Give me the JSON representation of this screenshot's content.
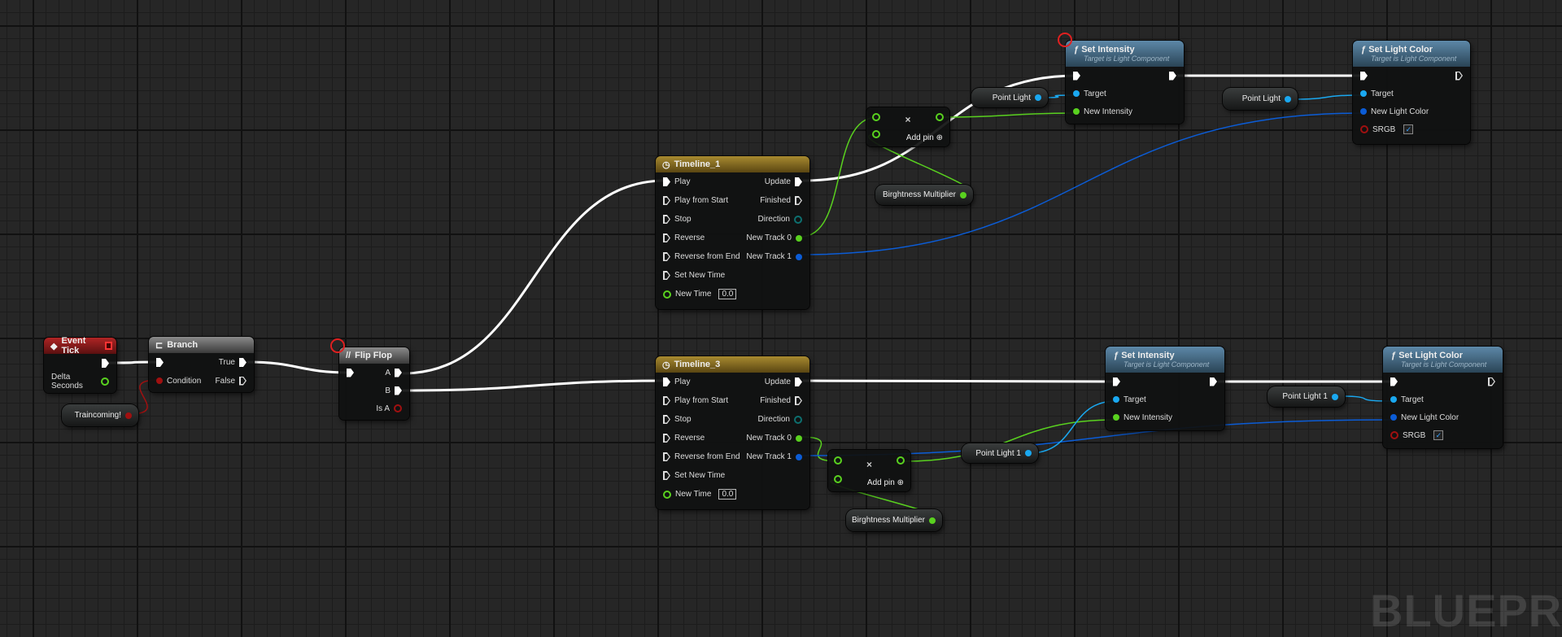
{
  "event_tick": {
    "title": "Event Tick",
    "delta": "Delta Seconds"
  },
  "branch": {
    "title": "Branch",
    "true": "True",
    "false": "False",
    "condition": "Condition"
  },
  "traincoming": {
    "label": "Traincoming!"
  },
  "flipflop": {
    "title": "Flip Flop",
    "a": "A",
    "b": "B",
    "is_a": "Is A"
  },
  "timeline_1": {
    "title": "Timeline_1",
    "inputs": [
      "Play",
      "Play from Start",
      "Stop",
      "Reverse",
      "Reverse from End",
      "Set New Time",
      "New Time"
    ],
    "outputs": [
      "Update",
      "Finished",
      "Direction",
      "New Track 0",
      "New Track 1"
    ],
    "new_time_value": "0.0"
  },
  "timeline_3": {
    "title": "Timeline_3",
    "inputs": [
      "Play",
      "Play from Start",
      "Stop",
      "Reverse",
      "Reverse from End",
      "Set New Time",
      "New Time"
    ],
    "outputs": [
      "Update",
      "Finished",
      "Direction",
      "New Track 0",
      "New Track 1"
    ],
    "new_time_value": "0.0"
  },
  "add_top": {
    "x": "×",
    "label": "Add pin"
  },
  "add_bottom": {
    "x": "×",
    "label": "Add pin"
  },
  "brightness_top": {
    "label": "Birghtness Multiplier"
  },
  "brightness_bottom": {
    "label": "Birghtness Multiplier"
  },
  "point_light_a": {
    "label": "Point Light"
  },
  "point_light_b": {
    "label": "Point Light"
  },
  "point_light_1_a": {
    "label": "Point Light 1"
  },
  "point_light_1_b": {
    "label": "Point Light 1"
  },
  "set_intensity_1": {
    "title": "Set Intensity",
    "subtitle": "Target is Light Component",
    "target": "Target",
    "new_intensity": "New Intensity"
  },
  "set_intensity_2": {
    "title": "Set Intensity",
    "subtitle": "Target is Light Component",
    "target": "Target",
    "new_intensity": "New Intensity"
  },
  "set_light_color_1": {
    "title": "Set Light Color",
    "subtitle": "Target is Light Component",
    "target": "Target",
    "new_color": "New Light Color",
    "srgb": "SRGB",
    "srgb_checked": true
  },
  "set_light_color_2": {
    "title": "Set Light Color",
    "subtitle": "Target is Light Component",
    "target": "Target",
    "new_color": "New Light Color",
    "srgb": "SRGB",
    "srgb_checked": true
  },
  "icons": {
    "func": "ƒ",
    "clock": "◷",
    "event": "◆",
    "branch": "⊏",
    "flipflop": "//",
    "check": "✓",
    "plus": "⊕"
  },
  "watermark": "BLUEPRINT",
  "colors": {
    "exec": "#ffffff",
    "float": "#59d11f",
    "object": "#1aa8f0",
    "struct": "#0b5cd6",
    "bool": "#a01010",
    "direction": "#0d6f6f"
  }
}
